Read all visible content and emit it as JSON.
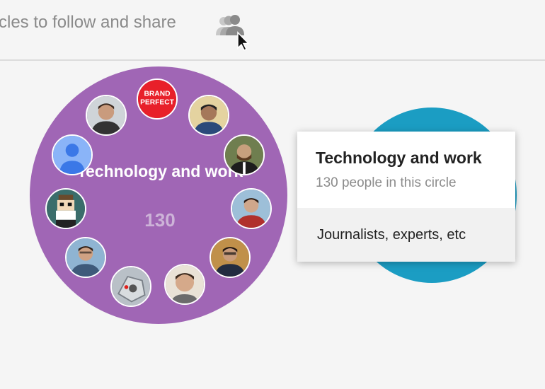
{
  "header": {
    "text": "cles to follow and share",
    "share_icon": "people-share-icon"
  },
  "circle": {
    "title": "Technology and work",
    "count": "130",
    "color": "#a066b5",
    "members": [
      {
        "name": "avatar-brand-perfect",
        "logo_text": "BRAND PERFECT"
      },
      {
        "name": "avatar-person"
      },
      {
        "name": "avatar-person"
      },
      {
        "name": "avatar-person"
      },
      {
        "name": "avatar-person"
      },
      {
        "name": "avatar-person"
      },
      {
        "name": "avatar-person"
      },
      {
        "name": "avatar-robot"
      },
      {
        "name": "avatar-person"
      },
      {
        "name": "avatar-pixel-character"
      },
      {
        "name": "avatar-default-profile-icon"
      },
      {
        "name": "avatar-person"
      }
    ]
  },
  "other_circle": {
    "color": "#1b9dc3"
  },
  "popup": {
    "title": "Technology and work",
    "subtitle": "130 people in this circle",
    "description": "Journalists, experts, etc"
  }
}
